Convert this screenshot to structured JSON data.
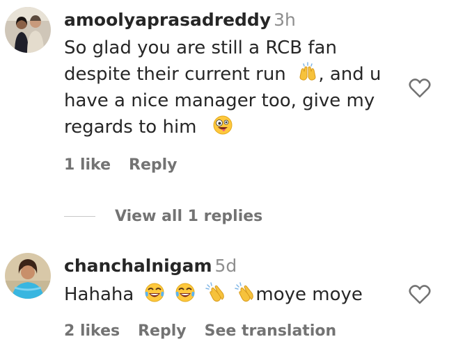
{
  "comments": [
    {
      "username": "amoolyaprasadreddy",
      "time": "3h",
      "lines": [
        "So glad you are still a RCB fan",
        "despite their current run",
        ", and u",
        "have a nice manager too, give my",
        "regards to him"
      ],
      "likes": "1 like",
      "reply": "Reply",
      "view_replies": "View all 1 replies"
    },
    {
      "username": "chanchalnigam",
      "time": "5d",
      "text_start": "Hahaha",
      "text_end": "moye moye",
      "likes": "2 likes",
      "reply": "Reply",
      "translate": "See translation"
    }
  ],
  "icons": {
    "heart": "heart-outline-icon",
    "raising_hands": "raising-hands-emoji",
    "zany_face": "zany-face-emoji",
    "tears_of_joy": "tears-of-joy-emoji",
    "clapping": "clapping-hands-emoji"
  },
  "colors": {
    "text": "#262626",
    "secondary": "#737373",
    "timestamp": "#8e8e8e"
  }
}
